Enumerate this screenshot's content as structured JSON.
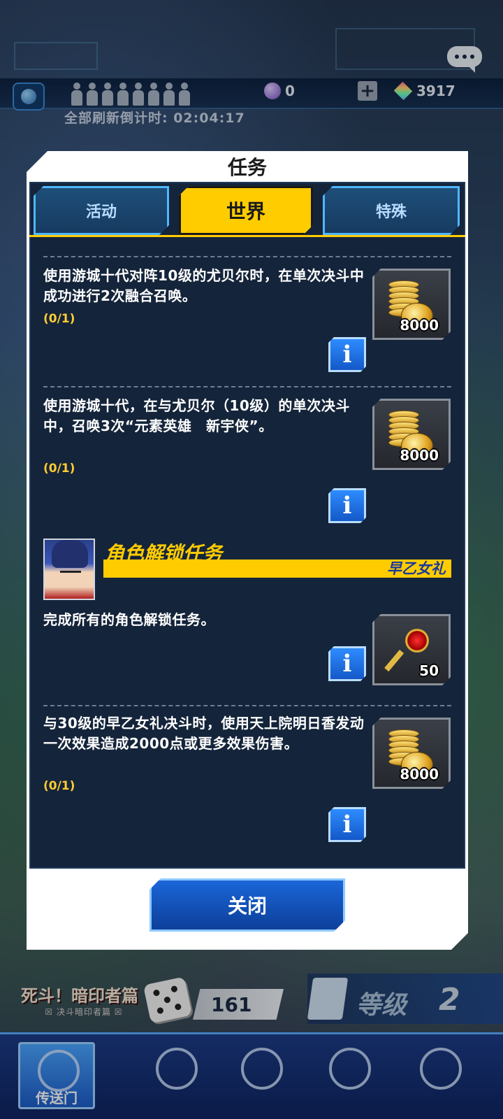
{
  "status": {
    "countdown": "全部刷新倒计时: 02:04:17",
    "purple_gems": "0",
    "rainbow_gems": "3917"
  },
  "modal": {
    "title": "任务",
    "tabs": [
      {
        "label": "活动",
        "active": false
      },
      {
        "label": "世界",
        "active": true
      },
      {
        "label": "特殊",
        "active": false
      }
    ],
    "missions": [
      {
        "text": "使用游城十代对阵10级的尤贝尔时，在单次决斗中成功进行2次融合召唤。",
        "progress": "(0/1)",
        "reward_icon": "gold-coins-icon",
        "reward_amount": "8000"
      },
      {
        "text": "使用游城十代，在与尤贝尔（10级）的单次决斗中，召唤3次“元素英雄　新宇侠”。",
        "progress": "(0/1)",
        "reward_icon": "gold-coins-icon",
        "reward_amount": "8000"
      }
    ],
    "character_section": {
      "title": "角色解锁任务",
      "character_name": "早乙女礼",
      "missions": [
        {
          "text": "完成所有的角色解锁任务。",
          "progress": "",
          "reward_icon": "ruby-key-icon",
          "reward_amount": "50"
        },
        {
          "text": "与30级的早乙女礼决斗时，使用天上院明日香发动一次效果造成2000点或更多效果伤害。",
          "progress": "(0/1)",
          "reward_icon": "gold-coins-icon",
          "reward_amount": "8000"
        }
      ]
    },
    "close_label": "关闭"
  },
  "bottom": {
    "event_logo": "死斗！暗印者篇",
    "event_sub": "☒ 决斗暗印者篇 ☒",
    "dice_count": "161",
    "level_label": "等级",
    "level_value": "2",
    "nav": [
      {
        "label": "传送门",
        "icon": "portal-icon"
      },
      {
        "label": "",
        "icon": "duel-swords-icon"
      },
      {
        "label": "",
        "icon": "shop-cart-icon"
      },
      {
        "label": "",
        "icon": "deck-cards-icon"
      },
      {
        "label": "",
        "icon": "duelist-emblem-icon"
      }
    ]
  },
  "colors": {
    "accent_yellow": "#ffcc00",
    "panel_bg": "#14243a",
    "button_blue": "#1a66d8"
  }
}
